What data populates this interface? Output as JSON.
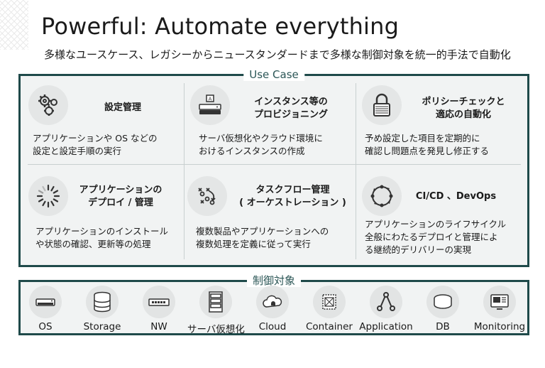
{
  "title": "Powerful: Automate everything",
  "subtitle": "多様なユースケース、レガシーからニュースタンダードまで多様な制御対象を統一的手法で自動化",
  "usecase": {
    "label": "Use Case",
    "cells": [
      {
        "icon": "gears-icon",
        "title": "設定管理",
        "desc": "アプリケーションや OS などの\n設定と設定手順の実行"
      },
      {
        "icon": "server-instance-icon",
        "title": "インスタンス等の\nプロビジョニング",
        "desc": "サーバ仮想化やクラウド環境に\nおけるインスタンスの作成"
      },
      {
        "icon": "padlock-icon",
        "title": "ポリシーチェックと\n適応の自動化",
        "desc": "予め設定した項目を定期的に\n確認し問題点を発見し修正する"
      },
      {
        "icon": "loading-spinner-icon",
        "title": "アプリケーションの\nデプロイ / 管理",
        "desc": "アプリケーションのインストール\nや状態の確認、更新等の処理"
      },
      {
        "icon": "tactics-board-icon",
        "title": "タスクフロー管理\n( オーケストレーション )",
        "desc": "複数製品やアプリケーションへの\n複数処理を定義に従って実行"
      },
      {
        "icon": "cycle-icon",
        "title": "CI/CD 、DevOps",
        "desc": "アプリケーションのライフサイクル\n全般にわたるデプロイと管理によ\nる継続的デリバリーの実現"
      }
    ]
  },
  "targets": {
    "label": "制御対象",
    "items": [
      {
        "icon": "os-device-icon",
        "label": "OS"
      },
      {
        "icon": "storage-icon",
        "label": "Storage"
      },
      {
        "icon": "network-switch-icon",
        "label": "NW"
      },
      {
        "icon": "server-rack-icon",
        "label": "サーバ仮想化"
      },
      {
        "icon": "cloud-icon",
        "label": "Cloud"
      },
      {
        "icon": "container-icon",
        "label": "Container"
      },
      {
        "icon": "application-icon",
        "label": "Application"
      },
      {
        "icon": "database-icon",
        "label": "DB"
      },
      {
        "icon": "monitoring-icon",
        "label": "Monitoring"
      }
    ]
  }
}
